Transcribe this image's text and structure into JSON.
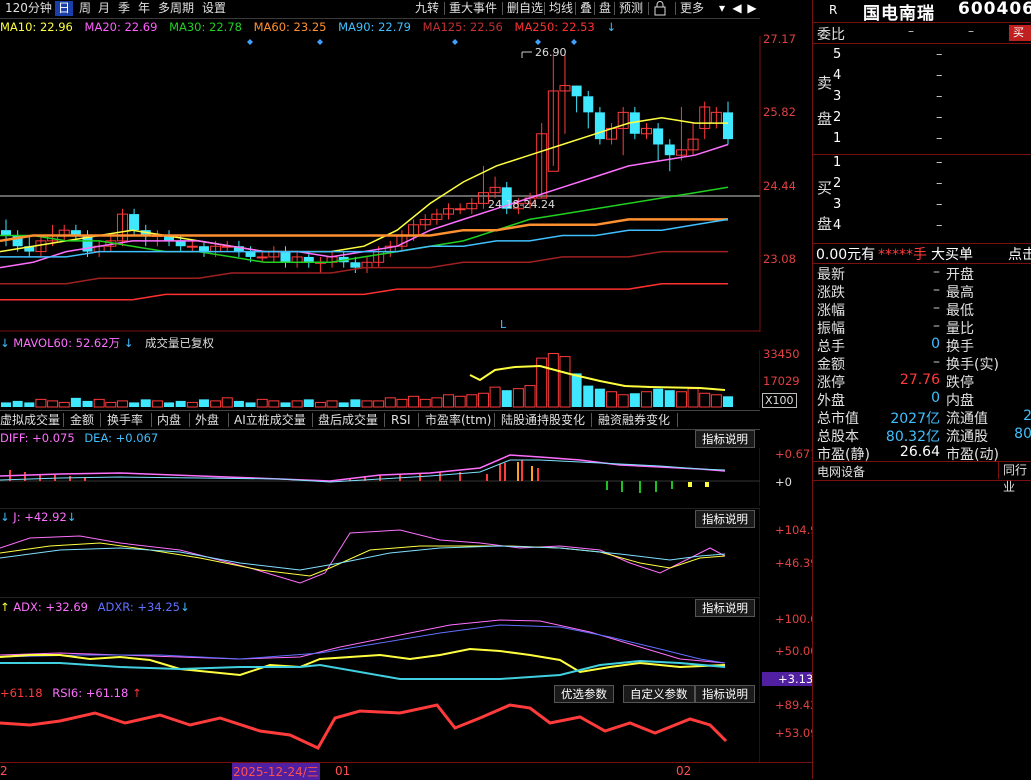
{
  "toolbar": {
    "left_items": [
      "120分钟",
      "日",
      "周",
      "月",
      "季",
      "年",
      "多周期",
      "设置"
    ],
    "active_index": 1,
    "right_items": [
      "九转",
      "重大事件",
      "删自选",
      "均线",
      "叠",
      "盘",
      "预测",
      "锁",
      "更多"
    ]
  },
  "ma_legend": [
    {
      "label": "MA10: 22.96",
      "color": "#ffff40"
    },
    {
      "label": "MA20: 22.69",
      "color": "#ff60ff"
    },
    {
      "label": "MA30: 22.78",
      "color": "#20d020"
    },
    {
      "label": "MA60: 23.25",
      "color": "#ff9030"
    },
    {
      "label": "MA90: 22.79",
      "color": "#40c0ff"
    },
    {
      "label": "MA125: 22.56",
      "color": "#c03030"
    },
    {
      "label": "MA250: 22.53",
      "color": "#ff3030"
    }
  ],
  "price_axis": [
    "27.17",
    "25.82",
    "24.44",
    "23.08"
  ],
  "annotations": {
    "high": "26.90",
    "range": "24.18-24.24",
    "marker": "L"
  },
  "volume": {
    "title": "MAVOL60: 52.62万",
    "note": "成交量已复权",
    "axis": [
      "33450",
      "17029"
    ],
    "scale": "X100"
  },
  "tabs": [
    "虚拟成交量",
    "金额",
    "换手率",
    "内盘",
    "外盘",
    "AI立桩成交量",
    "盘后成交量",
    "RSI",
    "市盈率(ttm)",
    "陆股通持股变化",
    "融资融券变化"
  ],
  "macd": {
    "title_a": "DIFF: +0.075",
    "title_b": "DEA: +0.067",
    "button": "指标说明",
    "axis": [
      "+0.671",
      "+0"
    ]
  },
  "kdj": {
    "title": "J: +42.92",
    "button": "指标说明",
    "axis": [
      "+104.9",
      "+46.39"
    ]
  },
  "dmi": {
    "title_a": "ADX: +32.69",
    "title_b": "ADXR: +34.25",
    "button": "指标说明",
    "axis": [
      "+100.0",
      "+50.00",
      "+3.13"
    ]
  },
  "rsi": {
    "title_a": "+61.18",
    "title_b": "RSI6: +61.18",
    "buttons": [
      "优选参数",
      "自定义参数",
      "指标说明"
    ],
    "axis": [
      "+89.42",
      "+53.09"
    ]
  },
  "dates": {
    "left": "2",
    "highlight": "2025-12-24/三",
    "mid": "01",
    "right": "02"
  },
  "stock": {
    "r_mark": "R",
    "name": "国电南瑞",
    "code": "600406",
    "wei_bi": "委比",
    "dash": "–",
    "buy_btn": "买",
    "sell_label": [
      "卖",
      "盘"
    ],
    "buy_label": [
      "买",
      "盘"
    ],
    "sell_levels": [
      "5",
      "4",
      "3",
      "2",
      "1"
    ],
    "buy_levels": [
      "1",
      "2",
      "3",
      "4"
    ],
    "big_order": "0.00元有",
    "big_order_mask": "*****手",
    "big_order_label": "大买单",
    "big_order_tail": "点击"
  },
  "quote_rows": [
    {
      "l": "最新",
      "lv": "–",
      "r": "开盘",
      "rv": ""
    },
    {
      "l": "涨跌",
      "lv": "–",
      "r": "最高",
      "rv": ""
    },
    {
      "l": "涨幅",
      "lv": "–",
      "r": "最低",
      "rv": ""
    },
    {
      "l": "振幅",
      "lv": "–",
      "r": "量比",
      "rv": ""
    },
    {
      "l": "总手",
      "lv": "0",
      "r": "换手",
      "rv": ""
    },
    {
      "l": "金额",
      "lv": "–",
      "r": "换手(实)",
      "rv": ""
    },
    {
      "l": "涨停",
      "lv": "27.76",
      "r": "跌停",
      "rv": ""
    },
    {
      "l": "外盘",
      "lv": "0",
      "r": "内盘",
      "rv": ""
    },
    {
      "l": "总市值",
      "lv": "2027亿",
      "r": "流通值",
      "rv": "2"
    },
    {
      "l": "总股本",
      "lv": "80.32亿",
      "r": "流通股",
      "rv": "80"
    },
    {
      "l": "市盈(静)",
      "lv": "26.64",
      "r": "市盈(动)",
      "rv": ""
    }
  ],
  "industry": {
    "label": "电网设备",
    "tab": "同行业"
  },
  "colors": {
    "up": "#ff3b3b",
    "down": "#40e8ff",
    "grid": "#7a1010"
  },
  "chart_data": {
    "type": "candlestick",
    "price_axis_labels": [
      23.08,
      24.44,
      25.82,
      27.17
    ],
    "candles": [
      [
        23.6,
        23.5,
        23.8,
        23.3
      ],
      [
        23.5,
        23.3,
        23.6,
        23.2
      ],
      [
        23.3,
        23.2,
        23.5,
        23.1
      ],
      [
        23.2,
        23.4,
        23.5,
        23.1
      ],
      [
        23.4,
        23.5,
        23.7,
        23.3
      ],
      [
        23.5,
        23.6,
        23.7,
        23.4
      ],
      [
        23.6,
        23.5,
        23.7,
        23.4
      ],
      [
        23.5,
        23.2,
        23.6,
        23.1
      ],
      [
        23.2,
        23.3,
        23.4,
        23.1
      ],
      [
        23.3,
        23.4,
        23.5,
        23.2
      ],
      [
        23.4,
        23.9,
        24.0,
        23.3
      ],
      [
        23.9,
        23.6,
        24.0,
        23.5
      ],
      [
        23.6,
        23.5,
        23.7,
        23.3
      ],
      [
        23.5,
        23.5,
        23.6,
        23.3
      ],
      [
        23.5,
        23.4,
        23.6,
        23.3
      ],
      [
        23.4,
        23.3,
        23.5,
        23.2
      ],
      [
        23.3,
        23.3,
        23.4,
        23.2
      ],
      [
        23.3,
        23.2,
        23.4,
        23.1
      ],
      [
        23.2,
        23.3,
        23.4,
        23.1
      ],
      [
        23.3,
        23.3,
        23.4,
        23.2
      ],
      [
        23.3,
        23.2,
        23.4,
        23.1
      ],
      [
        23.2,
        23.1,
        23.3,
        23.0
      ],
      [
        23.1,
        23.1,
        23.2,
        23.0
      ],
      [
        23.1,
        23.2,
        23.3,
        23.0
      ],
      [
        23.2,
        23.0,
        23.3,
        22.9
      ],
      [
        23.0,
        23.1,
        23.2,
        22.9
      ],
      [
        23.1,
        23.0,
        23.2,
        22.9
      ],
      [
        23.0,
        23.0,
        23.1,
        22.8
      ],
      [
        23.0,
        23.1,
        23.2,
        22.9
      ],
      [
        23.1,
        23.0,
        23.2,
        22.9
      ],
      [
        23.0,
        22.9,
        23.1,
        22.8
      ],
      [
        22.9,
        23.0,
        23.1,
        22.8
      ],
      [
        23.0,
        23.2,
        23.3,
        22.9
      ],
      [
        23.2,
        23.3,
        23.4,
        23.1
      ],
      [
        23.3,
        23.5,
        23.6,
        23.2
      ],
      [
        23.5,
        23.7,
        23.8,
        23.4
      ],
      [
        23.7,
        23.8,
        23.9,
        23.6
      ],
      [
        23.8,
        23.9,
        24.0,
        23.7
      ],
      [
        23.9,
        24.0,
        24.1,
        23.8
      ],
      [
        24.0,
        24.0,
        24.1,
        23.9
      ],
      [
        24.0,
        24.1,
        24.2,
        23.9
      ],
      [
        24.1,
        24.3,
        24.8,
        24.0
      ],
      [
        24.3,
        24.4,
        24.6,
        24.2
      ],
      [
        24.4,
        24.0,
        24.5,
        23.9
      ],
      [
        24.0,
        24.1,
        24.2,
        23.9
      ],
      [
        24.1,
        24.2,
        24.3,
        24.0
      ],
      [
        24.2,
        25.4,
        25.6,
        24.2
      ],
      [
        24.7,
        26.2,
        26.9,
        24.8
      ],
      [
        26.2,
        26.3,
        26.9,
        25.4
      ],
      [
        26.3,
        26.1,
        26.3,
        25.8
      ],
      [
        26.1,
        25.8,
        26.2,
        25.5
      ],
      [
        25.8,
        25.3,
        25.9,
        25.2
      ],
      [
        25.3,
        25.5,
        25.6,
        25.2
      ],
      [
        25.5,
        25.8,
        25.9,
        25.0
      ],
      [
        25.8,
        25.4,
        25.9,
        25.3
      ],
      [
        25.4,
        25.5,
        25.6,
        25.3
      ],
      [
        25.5,
        25.2,
        25.6,
        24.9
      ],
      [
        25.2,
        25.0,
        25.3,
        24.7
      ],
      [
        25.0,
        25.1,
        25.9,
        24.9
      ],
      [
        25.1,
        25.3,
        25.6,
        25.0
      ],
      [
        25.5,
        25.9,
        26.0,
        25.3
      ],
      [
        25.6,
        25.8,
        25.9,
        25.5
      ],
      [
        25.8,
        25.3,
        26.0,
        25.2
      ]
    ],
    "ma": [
      {
        "name": "MA10",
        "color": "#ffff40",
        "values": [
          23.2,
          23.3,
          23.4,
          23.5,
          23.6,
          23.5,
          23.4,
          23.3,
          23.2,
          23.2,
          23.2,
          23.3,
          23.6,
          24.1,
          24.5,
          24.8,
          25.0,
          25.2,
          25.4,
          25.6,
          25.7,
          25.6,
          25.6
        ]
      },
      {
        "name": "MA20",
        "color": "#ff70ff",
        "values": [
          22.9,
          23.0,
          23.2,
          23.3,
          23.4,
          23.4,
          23.4,
          23.3,
          23.2,
          23.2,
          23.1,
          23.2,
          23.3,
          23.6,
          23.8,
          24.0,
          24.2,
          24.4,
          24.6,
          24.8,
          24.9,
          25.0,
          25.2
        ]
      },
      {
        "name": "MA30",
        "color": "#20d020",
        "values": [
          23.5,
          23.5,
          23.4,
          23.4,
          23.3,
          23.2,
          23.2,
          23.1,
          23.0,
          23.0,
          23.0,
          23.1,
          23.2,
          23.3,
          23.4,
          23.6,
          23.8,
          23.9,
          24.0,
          24.1,
          24.2,
          24.3,
          24.4
        ]
      },
      {
        "name": "MA60",
        "color": "#ff9030",
        "values": [
          23.4,
          23.5,
          23.5,
          23.5,
          23.5,
          23.5,
          23.5,
          23.5,
          23.5,
          23.5,
          23.5,
          23.5,
          23.5,
          23.5,
          23.6,
          23.6,
          23.7,
          23.7,
          23.7,
          23.8,
          23.8,
          23.8,
          23.8
        ]
      },
      {
        "name": "MA90",
        "color": "#40c0ff",
        "values": [
          23.1,
          23.1,
          23.1,
          23.2,
          23.2,
          23.2,
          23.2,
          23.2,
          23.2,
          23.2,
          23.2,
          23.2,
          23.2,
          23.3,
          23.3,
          23.4,
          23.4,
          23.5,
          23.5,
          23.6,
          23.6,
          23.7,
          23.8
        ]
      },
      {
        "name": "MA125",
        "color": "#a02020",
        "values": [
          22.6,
          22.6,
          22.6,
          22.7,
          22.7,
          22.7,
          22.7,
          22.8,
          22.8,
          22.8,
          22.8,
          22.9,
          22.9,
          22.9,
          23.0,
          23.0,
          23.0,
          23.1,
          23.1,
          23.1,
          23.2,
          23.2,
          23.2
        ]
      },
      {
        "name": "MA250",
        "color": "#ff3030",
        "values": [
          22.3,
          22.3,
          22.3,
          22.3,
          22.3,
          22.4,
          22.4,
          22.4,
          22.4,
          22.4,
          22.4,
          22.4,
          22.5,
          22.5,
          22.5,
          22.5,
          22.5,
          22.5,
          22.5,
          22.5,
          22.6,
          22.6,
          22.6
        ]
      }
    ],
    "volume": [
      3,
      4,
      3,
      5,
      4,
      3,
      6,
      4,
      5,
      3,
      4,
      3,
      5,
      4,
      3,
      4,
      3,
      5,
      4,
      6,
      4,
      3,
      5,
      4,
      3,
      4,
      5,
      3,
      4,
      3,
      5,
      4,
      4,
      6,
      5,
      7,
      5,
      6,
      8,
      7,
      8,
      9,
      13,
      11,
      12,
      14,
      32,
      35,
      33,
      22,
      14,
      12,
      10,
      8,
      9,
      10,
      12,
      11,
      10,
      12,
      9,
      8,
      7
    ]
  }
}
